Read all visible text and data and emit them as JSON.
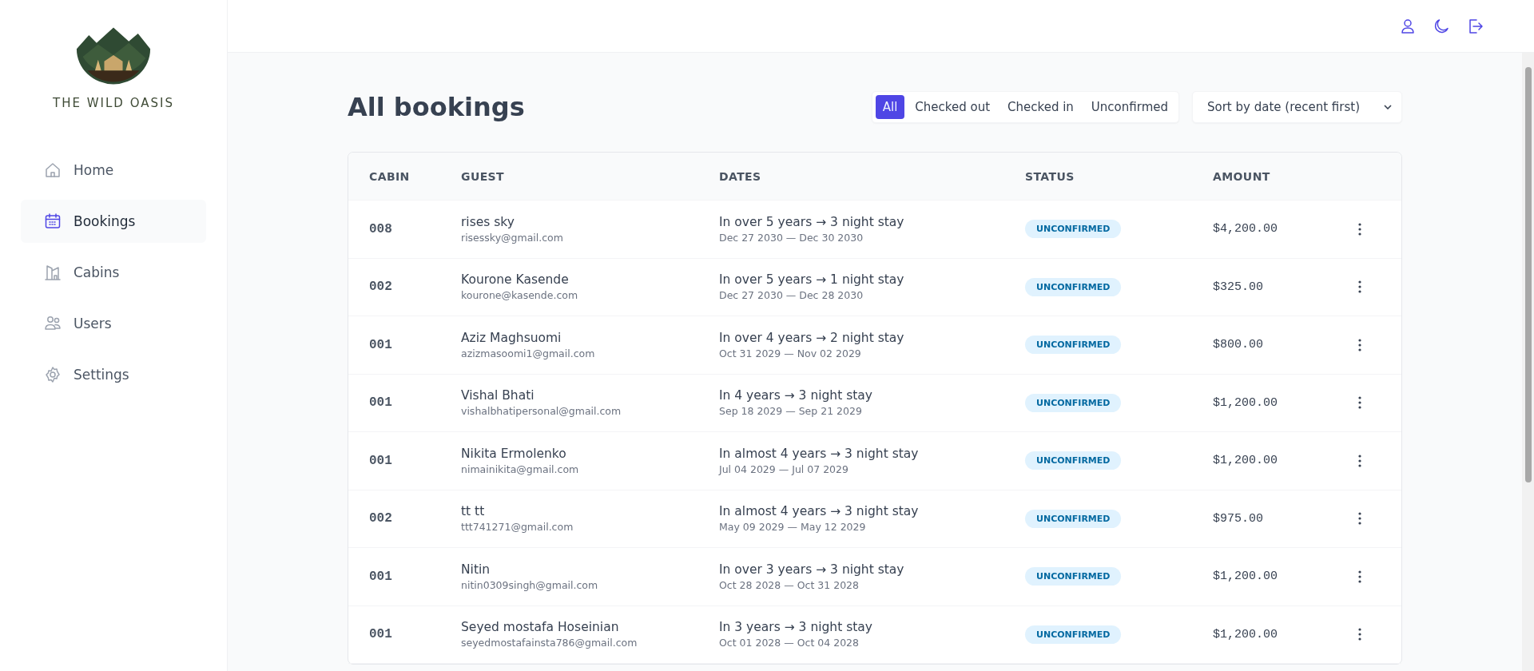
{
  "sidebar": {
    "brand": "THE WILD OASIS",
    "items": [
      {
        "label": "Home",
        "selected": false
      },
      {
        "label": "Bookings",
        "selected": true
      },
      {
        "label": "Cabins",
        "selected": false
      },
      {
        "label": "Users",
        "selected": false
      },
      {
        "label": "Settings",
        "selected": false
      }
    ]
  },
  "page": {
    "title": "All bookings",
    "filters": [
      {
        "label": "All",
        "selected": true
      },
      {
        "label": "Checked out",
        "selected": false
      },
      {
        "label": "Checked in",
        "selected": false
      },
      {
        "label": "Unconfirmed",
        "selected": false
      }
    ],
    "sort": {
      "value": "Sort by date (recent first)"
    }
  },
  "table": {
    "columns": [
      "CABIN",
      "GUEST",
      "DATES",
      "STATUS",
      "AMOUNT"
    ],
    "rows": [
      {
        "cabin": "008",
        "guest": "rises sky",
        "email": "risessky@gmail.com",
        "when": "In over 5 years → 3 night stay",
        "dates": "Dec 27 2030 — Dec 30 2030",
        "status": "UNCONFIRMED",
        "kind": "unconfirmed",
        "amount": "$4,200.00"
      },
      {
        "cabin": "002",
        "guest": "Kourone Kasende",
        "email": "kourone@kasende.com",
        "when": "In over 5 years → 1 night stay",
        "dates": "Dec 27 2030 — Dec 28 2030",
        "status": "UNCONFIRMED",
        "kind": "unconfirmed",
        "amount": "$325.00"
      },
      {
        "cabin": "001",
        "guest": "Aziz Maghsuomi",
        "email": "azizmasoomi1@gmail.com",
        "when": "In over 4 years → 2 night stay",
        "dates": "Oct 31 2029 — Nov 02 2029",
        "status": "UNCONFIRMED",
        "kind": "unconfirmed",
        "amount": "$800.00"
      },
      {
        "cabin": "001",
        "guest": "Vishal Bhati",
        "email": "vishalbhatipersonal@gmail.com",
        "when": "In 4 years → 3 night stay",
        "dates": "Sep 18 2029 — Sep 21 2029",
        "status": "UNCONFIRMED",
        "kind": "unconfirmed",
        "amount": "$1,200.00"
      },
      {
        "cabin": "001",
        "guest": "Nikita Ermolenko",
        "email": "nimainikita@gmail.com",
        "when": "In almost 4 years → 3 night stay",
        "dates": "Jul 04 2029 — Jul 07 2029",
        "status": "UNCONFIRMED",
        "kind": "unconfirmed",
        "amount": "$1,200.00"
      },
      {
        "cabin": "002",
        "guest": "tt tt",
        "email": "ttt741271@gmail.com",
        "when": "In almost 4 years → 3 night stay",
        "dates": "May 09 2029 — May 12 2029",
        "status": "UNCONFIRMED",
        "kind": "unconfirmed",
        "amount": "$975.00"
      },
      {
        "cabin": "001",
        "guest": "Nitin",
        "email": "nitin0309singh@gmail.com",
        "when": "In over 3 years → 3 night stay",
        "dates": "Oct 28 2028 — Oct 31 2028",
        "status": "UNCONFIRMED",
        "kind": "unconfirmed",
        "amount": "$1,200.00"
      },
      {
        "cabin": "001",
        "guest": "Seyed mostafa Hoseinian",
        "email": "seyedmostafainsta786@gmail.com",
        "when": "In 3 years → 3 night stay",
        "dates": "Oct 01 2028 — Oct 04 2028",
        "status": "UNCONFIRMED",
        "kind": "unconfirmed",
        "amount": "$1,200.00"
      }
    ]
  }
}
